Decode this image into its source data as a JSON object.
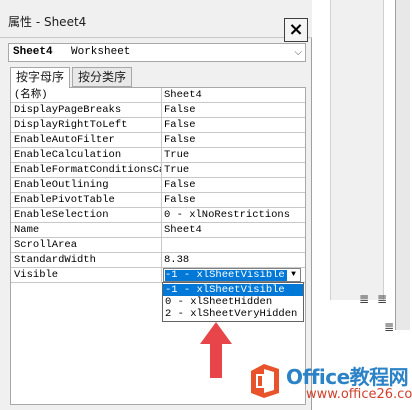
{
  "pane": {
    "title": "属性 - Sheet4",
    "close_glyph": "×",
    "object_selector": {
      "name": "Sheet4",
      "type": "Worksheet",
      "arrow": "⌵"
    },
    "tabs": [
      {
        "label": "按字母序"
      },
      {
        "label": "按分类序"
      }
    ]
  },
  "properties": [
    {
      "key": "(名称)",
      "value": "Sheet4"
    },
    {
      "key": "DisplayPageBreaks",
      "value": "False"
    },
    {
      "key": "DisplayRightToLeft",
      "value": "False"
    },
    {
      "key": "EnableAutoFilter",
      "value": "False"
    },
    {
      "key": "EnableCalculation",
      "value": "True"
    },
    {
      "key": "EnableFormatConditionsCalculation",
      "value": "True"
    },
    {
      "key": "EnableOutlining",
      "value": "False"
    },
    {
      "key": "EnablePivotTable",
      "value": "False"
    },
    {
      "key": "EnableSelection",
      "value": "0 - xlNoRestrictions"
    },
    {
      "key": "Name",
      "value": "Sheet4"
    },
    {
      "key": "ScrollArea",
      "value": ""
    },
    {
      "key": "StandardWidth",
      "value": "8.38"
    },
    {
      "key": "Visible",
      "value": "-1 - xlSheetVisible"
    }
  ],
  "visible_dropdown": {
    "options": [
      "-1 - xlSheetVisible",
      "0 - xlSheetHidden",
      "2 - xlSheetVeryHidden"
    ],
    "selected_index": 0,
    "button_glyph": "▼"
  },
  "watermark": {
    "brand": "Office教程网",
    "site": "www.office26.com"
  },
  "colors": {
    "selection": "#0078d7",
    "arrow": "#e8454a",
    "brand_blue": "#2b82c6",
    "logo_orange": "#e8532b"
  },
  "icons": [
    "close-icon",
    "chevron-down-icon",
    "dropdown-arrow-icon",
    "align-icon",
    "office-logo-icon"
  ]
}
